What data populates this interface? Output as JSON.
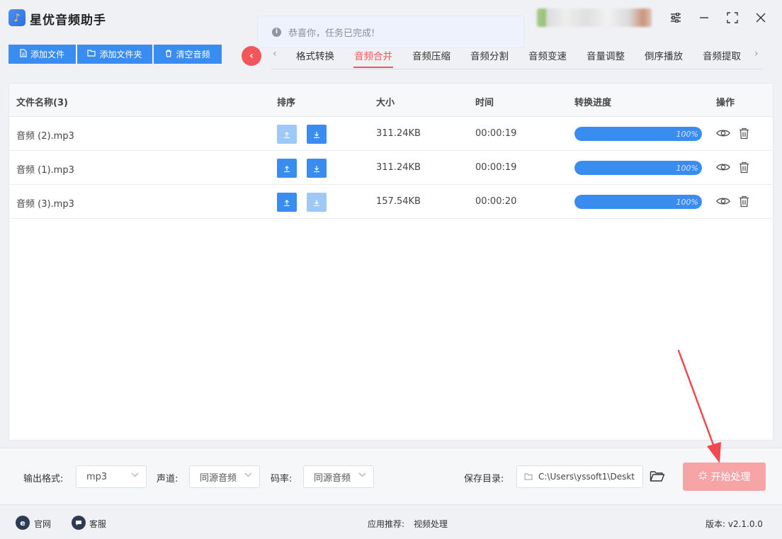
{
  "app": {
    "title": "星优音频助手",
    "logo_icon": "music-note-icon"
  },
  "toast": {
    "message": "恭喜你，任务已完成!",
    "icon": "info-icon"
  },
  "toolbar": {
    "add_file": "添加文件",
    "add_folder": "添加文件夹",
    "clear": "清空音频"
  },
  "tabs": [
    "格式转换",
    "音频合并",
    "音频压缩",
    "音频分割",
    "音频变速",
    "音量调整",
    "倒序播放",
    "音频提取"
  ],
  "active_tab": "音频合并",
  "table": {
    "headers": {
      "name": "文件名称(3)",
      "sort": "排序",
      "size": "大小",
      "time": "时间",
      "progress": "转换进度",
      "actions": "操作"
    },
    "rows": [
      {
        "name": "音频 (2).mp3",
        "size": "311.24KB",
        "time": "00:00:19",
        "progress": "100%",
        "progress_value": 1.0,
        "up_disabled": true,
        "down_disabled": false
      },
      {
        "name": "音频 (1).mp3",
        "size": "311.24KB",
        "time": "00:00:19",
        "progress": "100%",
        "progress_value": 1.0,
        "up_disabled": false,
        "down_disabled": false
      },
      {
        "name": "音频 (3).mp3",
        "size": "157.54KB",
        "time": "00:00:20",
        "progress": "100%",
        "progress_value": 1.0,
        "up_disabled": false,
        "down_disabled": true
      }
    ]
  },
  "settings": {
    "format_label": "输出格式:",
    "format_value": "mp3",
    "channel_label": "声道:",
    "channel_value": "同源音频",
    "bitrate_label": "码率:",
    "bitrate_value": "同源音频",
    "save_label": "保存目录:",
    "save_path": "C:\\Users\\yssoft1\\Deskt",
    "start_button": "开始处理"
  },
  "statusbar": {
    "website": "官网",
    "support": "客服",
    "recommend_label": "应用推荐:",
    "recommend_link": "视频处理",
    "version": "版本: v2.1.0.0"
  },
  "colors": {
    "primary": "#3a8df0",
    "accent": "#f0565a",
    "start_button": "#f7a4a6"
  }
}
